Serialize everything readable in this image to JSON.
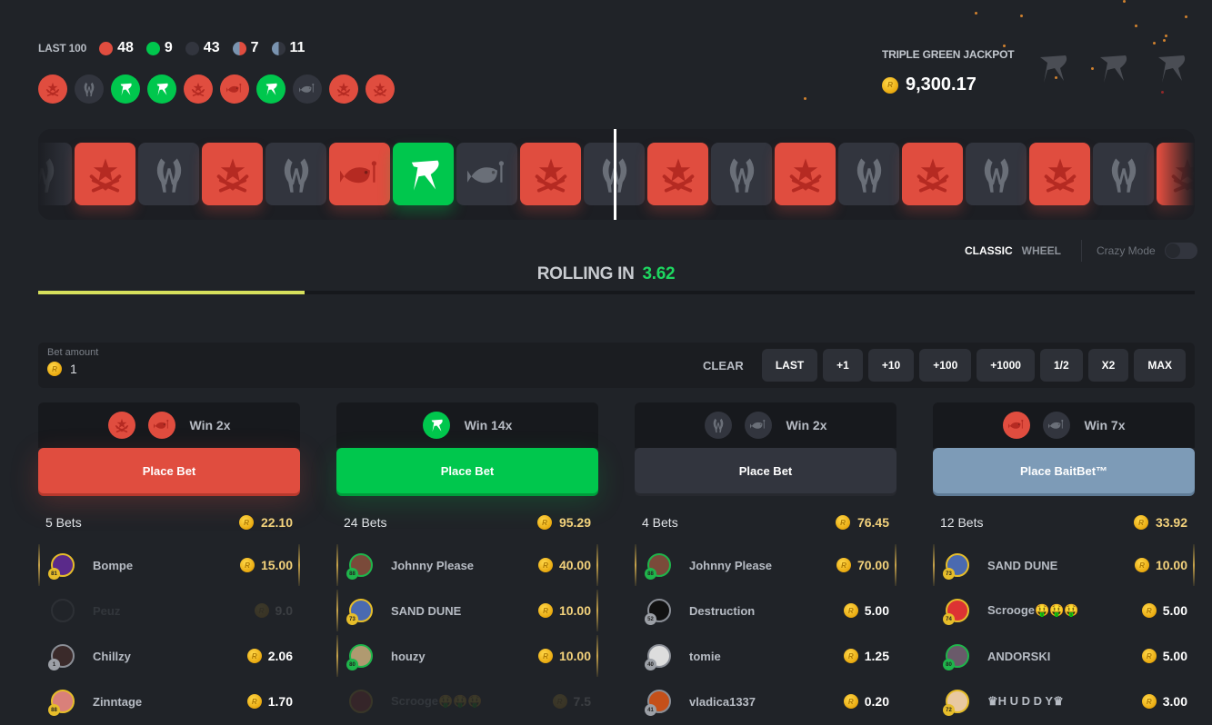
{
  "last100": {
    "label": "LAST 100",
    "stats": [
      {
        "kind": "red",
        "count": "48"
      },
      {
        "kind": "green",
        "count": "9"
      },
      {
        "kind": "dark",
        "count": "43"
      },
      {
        "kind": "half-red",
        "count": "7"
      },
      {
        "kind": "half-dark",
        "count": "11"
      }
    ]
  },
  "history": [
    {
      "color": "red",
      "icon": "t-icon"
    },
    {
      "color": "dark",
      "icon": "ct-icon"
    },
    {
      "color": "green",
      "icon": "r-logo-icon"
    },
    {
      "color": "green",
      "icon": "r-logo-icon"
    },
    {
      "color": "red",
      "icon": "t-icon"
    },
    {
      "color": "red",
      "icon": "fish-icon"
    },
    {
      "color": "green",
      "icon": "r-logo-icon"
    },
    {
      "color": "dark",
      "icon": "fish-icon"
    },
    {
      "color": "red",
      "icon": "t-icon"
    },
    {
      "color": "red",
      "icon": "t-icon"
    }
  ],
  "jackpot": {
    "title": "TRIPLE GREEN JACKPOT",
    "amount": "9,300.17"
  },
  "strip": [
    {
      "color": "dark",
      "icon": "ct-icon"
    },
    {
      "color": "red",
      "icon": "t-icon"
    },
    {
      "color": "dark",
      "icon": "ct-icon"
    },
    {
      "color": "red",
      "icon": "t-icon"
    },
    {
      "color": "dark",
      "icon": "ct-icon"
    },
    {
      "color": "red",
      "icon": "fish-icon"
    },
    {
      "color": "green",
      "icon": "r-logo-icon"
    },
    {
      "color": "dark",
      "icon": "fish-icon"
    },
    {
      "color": "red",
      "icon": "t-icon"
    },
    {
      "color": "dark",
      "icon": "ct-icon"
    },
    {
      "color": "red",
      "icon": "t-icon"
    },
    {
      "color": "dark",
      "icon": "ct-icon"
    },
    {
      "color": "red",
      "icon": "t-icon"
    },
    {
      "color": "dark",
      "icon": "ct-icon"
    },
    {
      "color": "red",
      "icon": "t-icon"
    },
    {
      "color": "dark",
      "icon": "ct-icon"
    },
    {
      "color": "red",
      "icon": "t-icon"
    },
    {
      "color": "dark",
      "icon": "ct-icon"
    },
    {
      "color": "red",
      "icon": "t-icon"
    }
  ],
  "modes": {
    "classic": "CLASSIC",
    "wheel": "WHEEL",
    "crazy": "Crazy Mode",
    "crazy_enabled": false
  },
  "rolling": {
    "label": "ROLLING IN",
    "time": "3.62",
    "progress": 0.23
  },
  "bet": {
    "label": "Bet amount",
    "value": "1",
    "clear": "CLEAR",
    "buttons": [
      "LAST",
      "+1",
      "+10",
      "+100",
      "+1000",
      "1/2",
      "X2",
      "MAX"
    ]
  },
  "columns": [
    {
      "icons": [
        {
          "color": "red",
          "icon": "t-icon"
        },
        {
          "color": "red",
          "icon": "fish-icon"
        }
      ],
      "win": "Win 2x",
      "button": "Place Bet",
      "theme": "red",
      "count": "5 Bets",
      "total": "22.10",
      "rows": [
        {
          "name": "Bompe",
          "amount": "15.00",
          "level": "81",
          "ring": "gold",
          "hl": true,
          "av": "#5a2a8a"
        },
        {
          "name": "Peuz",
          "amount": "9.0",
          "level": "",
          "ring": "",
          "faded": true,
          "av": "#2a2c33"
        },
        {
          "name": "Chillzy",
          "amount": "2.06",
          "level": "1",
          "ring": "",
          "av": "#3a2a2a"
        },
        {
          "name": "Zinntage",
          "amount": "1.70",
          "level": "88",
          "ring": "gold",
          "av": "#d9807a"
        }
      ]
    },
    {
      "icons": [
        {
          "color": "green",
          "icon": "r-logo-icon"
        }
      ],
      "win": "Win 14x",
      "button": "Place Bet",
      "theme": "green",
      "count": "24 Bets",
      "total": "95.29",
      "rows": [
        {
          "name": "Johnny Please",
          "amount": "40.00",
          "level": "88",
          "ring": "green",
          "hl": true,
          "av": "#7a4a3a"
        },
        {
          "name": "SAND DUNE",
          "amount": "10.00",
          "level": "73",
          "ring": "gold",
          "hl": true,
          "av": "#4a6ab0"
        },
        {
          "name": "houzy",
          "amount": "10.00",
          "level": "80",
          "ring": "green",
          "hl": true,
          "av": "#b09a70"
        },
        {
          "name": "Scrooge🤑🤑🤑",
          "amount": "7.5",
          "level": "",
          "ring": "gold",
          "faded": true,
          "av": "#c33"
        }
      ]
    },
    {
      "icons": [
        {
          "color": "dark",
          "icon": "ct-icon"
        },
        {
          "color": "dark",
          "icon": "fish-icon"
        }
      ],
      "win": "Win 2x",
      "button": "Place Bet",
      "theme": "dark",
      "count": "4 Bets",
      "total": "76.45",
      "rows": [
        {
          "name": "Johnny Please",
          "amount": "70.00",
          "level": "88",
          "ring": "green",
          "hl": true,
          "av": "#7a4a3a"
        },
        {
          "name": "Destruction",
          "amount": "5.00",
          "level": "52",
          "ring": "",
          "av": "#111"
        },
        {
          "name": "tomie",
          "amount": "1.25",
          "level": "40",
          "ring": "",
          "av": "#ddd"
        },
        {
          "name": "vladica1337",
          "amount": "0.20",
          "level": "41",
          "ring": "",
          "av": "#c4501a"
        }
      ]
    },
    {
      "icons": [
        {
          "color": "red",
          "icon": "fish-icon"
        },
        {
          "color": "dark",
          "icon": "fish-icon"
        }
      ],
      "win": "Win 7x",
      "button": "Place BaitBet™",
      "theme": "blue",
      "count": "12 Bets",
      "total": "33.92",
      "rows": [
        {
          "name": "SAND DUNE",
          "amount": "10.00",
          "level": "73",
          "ring": "gold",
          "hl": true,
          "av": "#4a6ab0"
        },
        {
          "name": "Scrooge🤑🤑🤑",
          "amount": "5.00",
          "level": "74",
          "ring": "gold",
          "av": "#d33"
        },
        {
          "name": "ANDORSKI",
          "amount": "5.00",
          "level": "80",
          "ring": "green",
          "av": "#6a5a6a"
        },
        {
          "name": "♛H U D D Y♛",
          "amount": "3.00",
          "level": "72",
          "ring": "gold",
          "av": "#e8c8a0"
        }
      ]
    }
  ]
}
